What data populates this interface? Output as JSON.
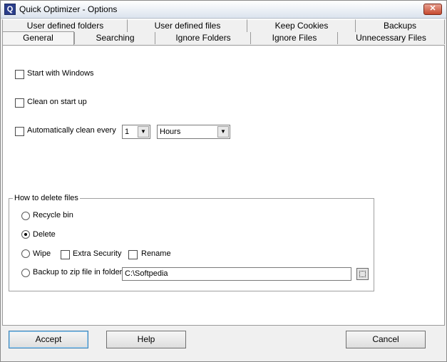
{
  "window": {
    "title": "Quick Optimizer - Options",
    "app_icon": "Q",
    "close_glyph": "✕"
  },
  "tabs_back": [
    {
      "label": "User defined folders"
    },
    {
      "label": "User defined files"
    },
    {
      "label": "Keep Cookies"
    },
    {
      "label": "Backups"
    }
  ],
  "tabs_front": [
    {
      "label": "General",
      "active": true
    },
    {
      "label": "Searching"
    },
    {
      "label": "Ignore Folders"
    },
    {
      "label": "Ignore Files"
    },
    {
      "label": "Unnecessary Files"
    }
  ],
  "general": {
    "start_with_windows": {
      "label": "Start with Windows",
      "checked": false
    },
    "clean_on_startup": {
      "label": "Clean on start up",
      "checked": false
    },
    "auto_clean": {
      "label": "Automatically clean every",
      "checked": false
    },
    "interval_value": "1",
    "interval_unit": "Hours"
  },
  "delete_group": {
    "title": "How to delete files",
    "recycle_bin": "Recycle bin",
    "delete": "Delete",
    "wipe": "Wipe",
    "extra_security": "Extra Security",
    "rename": "Rename",
    "backup_zip": "Backup to zip file in folder",
    "backup_folder": "C:\\Softpedia",
    "selected": "delete"
  },
  "buttons": {
    "accept": "Accept",
    "help": "Help",
    "cancel": "Cancel"
  }
}
